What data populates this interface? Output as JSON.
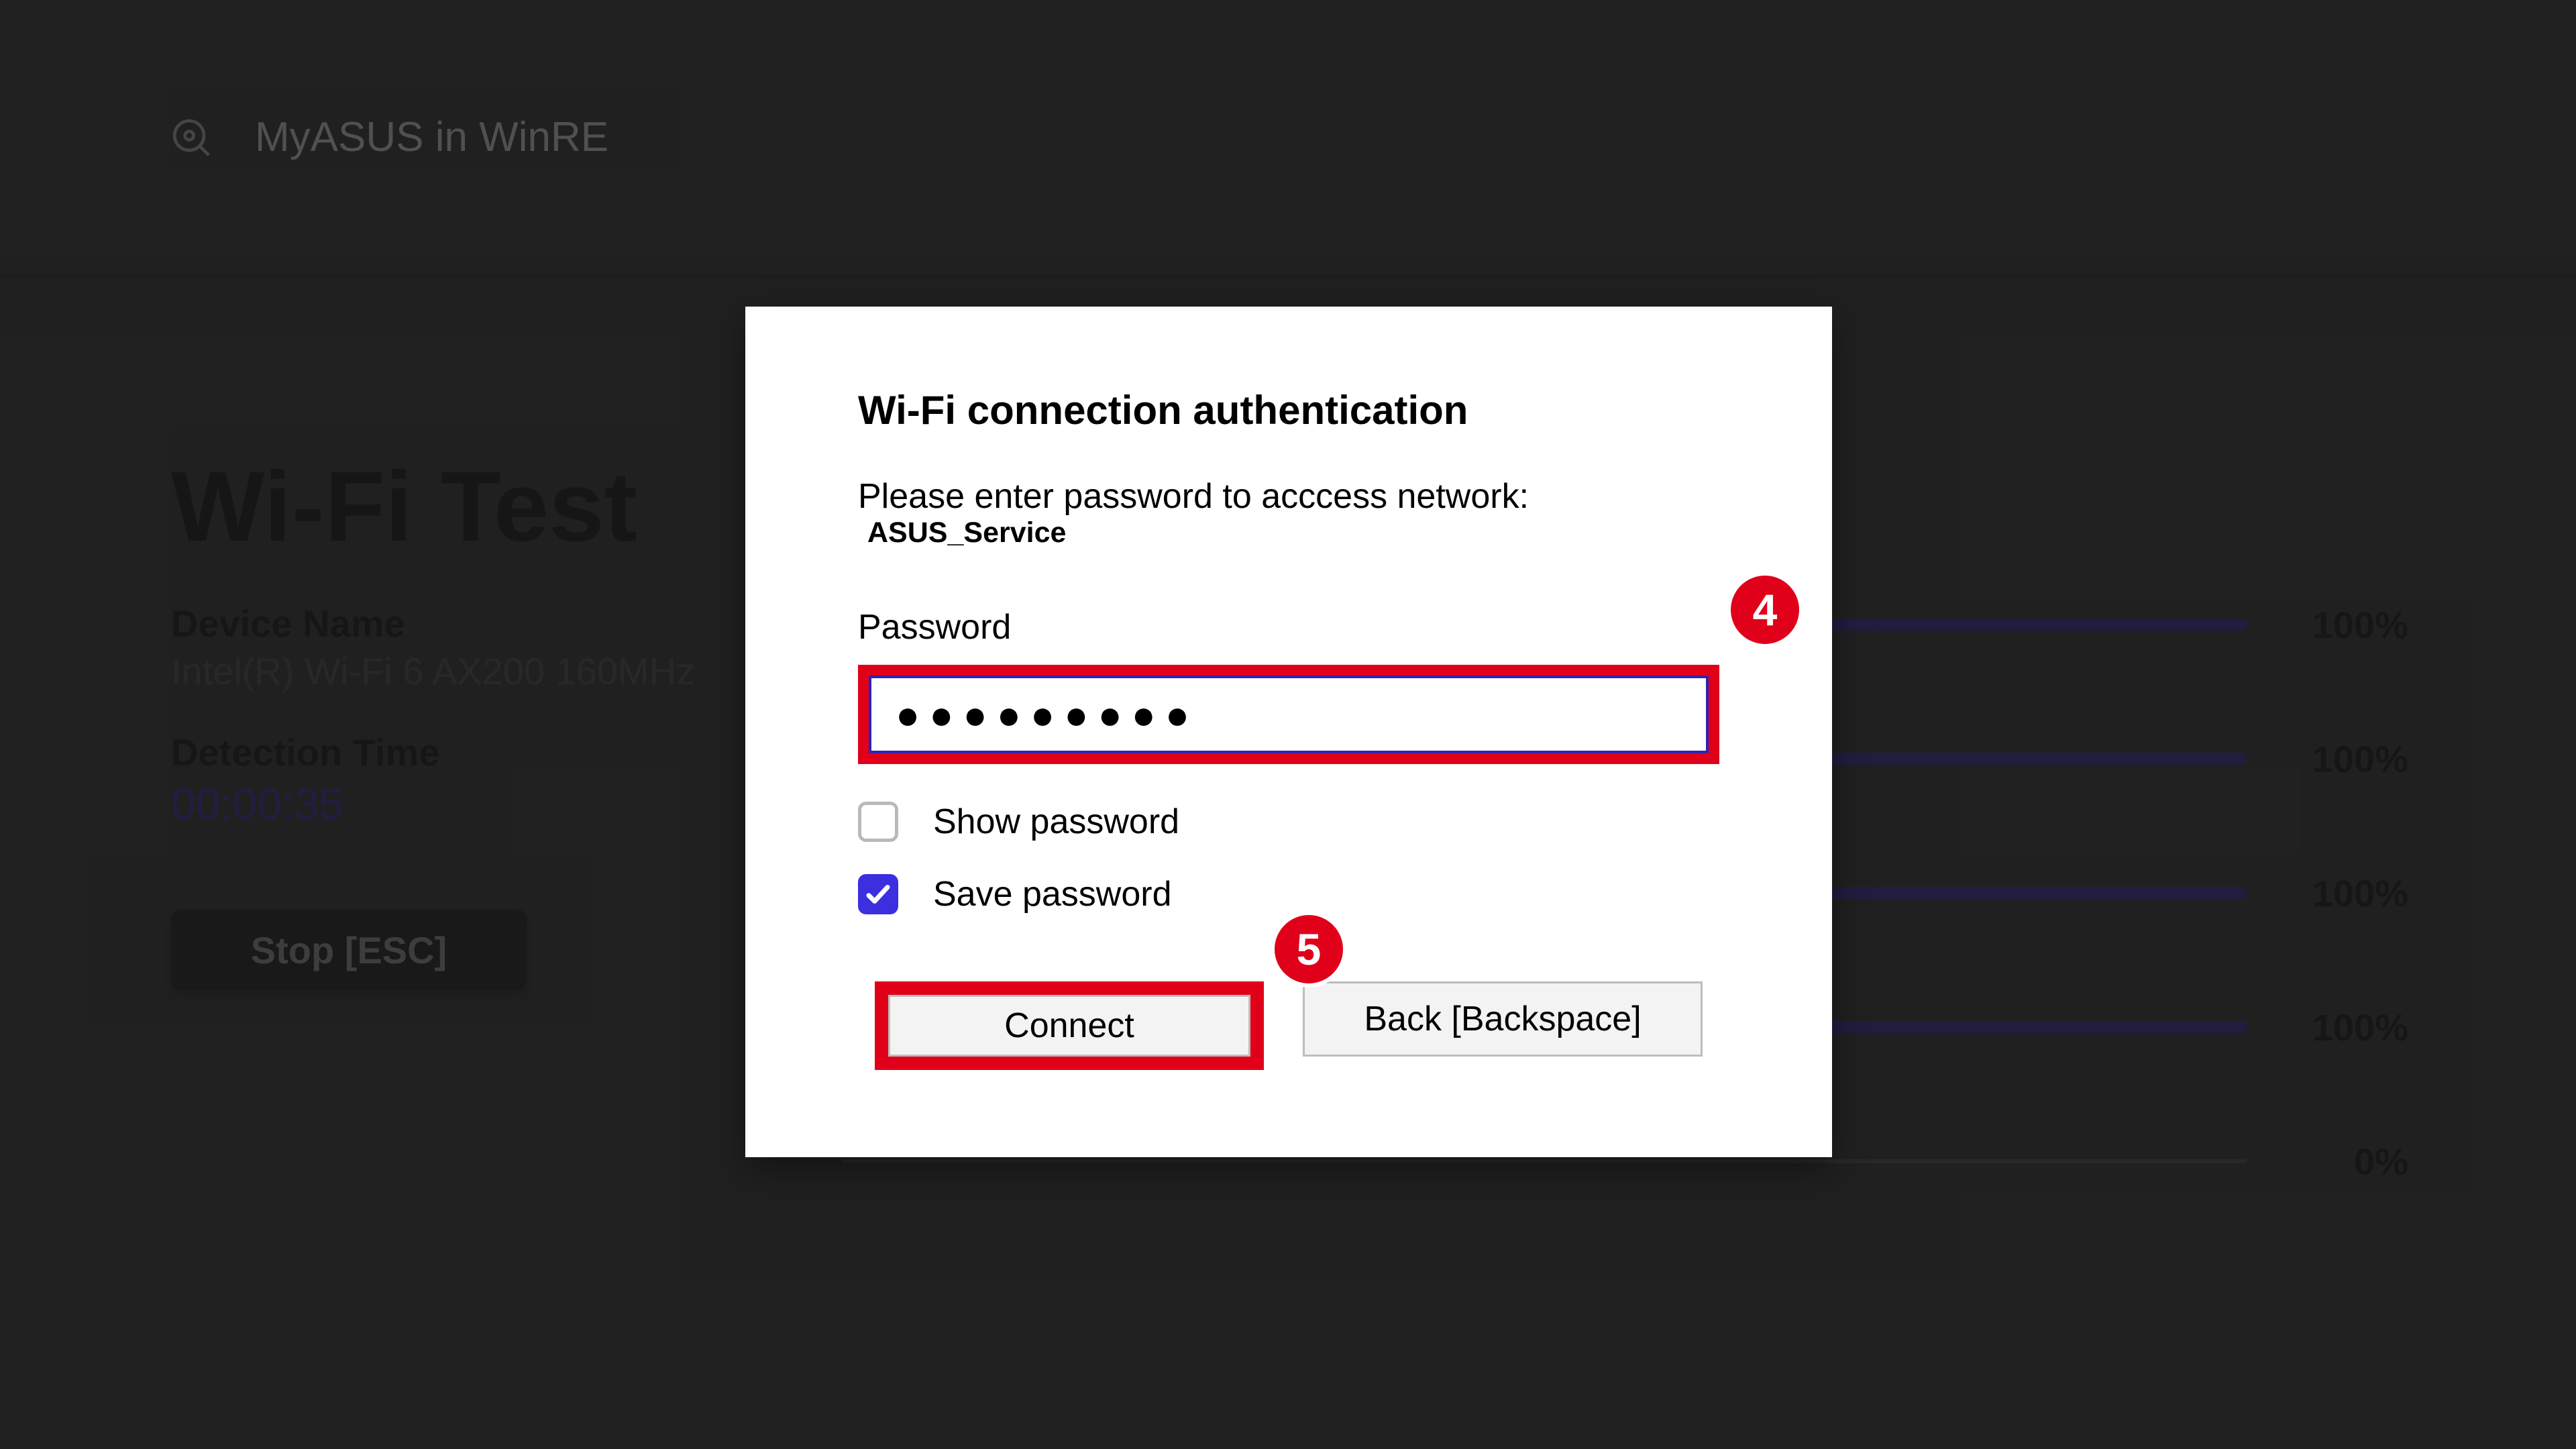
{
  "header": {
    "title": "MyASUS in WinRE"
  },
  "page": {
    "title": "Wi-Fi Test",
    "device_label": "Device Name",
    "device_value": "Intel(R) Wi-Fi 6 AX200 160MHz",
    "time_label": "Detection Time",
    "time_value": "00:00:35",
    "stop_label": "Stop [ESC]"
  },
  "progress": [
    {
      "pct": "100%"
    },
    {
      "pct": "100%"
    },
    {
      "pct": "100%"
    },
    {
      "pct": "100%"
    },
    {
      "pct": "0%"
    }
  ],
  "dialog": {
    "title": "Wi-Fi connection authentication",
    "subtitle": "Please enter password to acccess network:",
    "network": "ASUS_Service",
    "password_label": "Password",
    "password_value": "●●●●●●●●●",
    "show_pw_label": "Show password",
    "save_pw_label": "Save password",
    "show_pw_checked": false,
    "save_pw_checked": true,
    "connect_label": "Connect",
    "back_label": "Back [Backspace]"
  },
  "callouts": {
    "four": "4",
    "five": "5"
  }
}
